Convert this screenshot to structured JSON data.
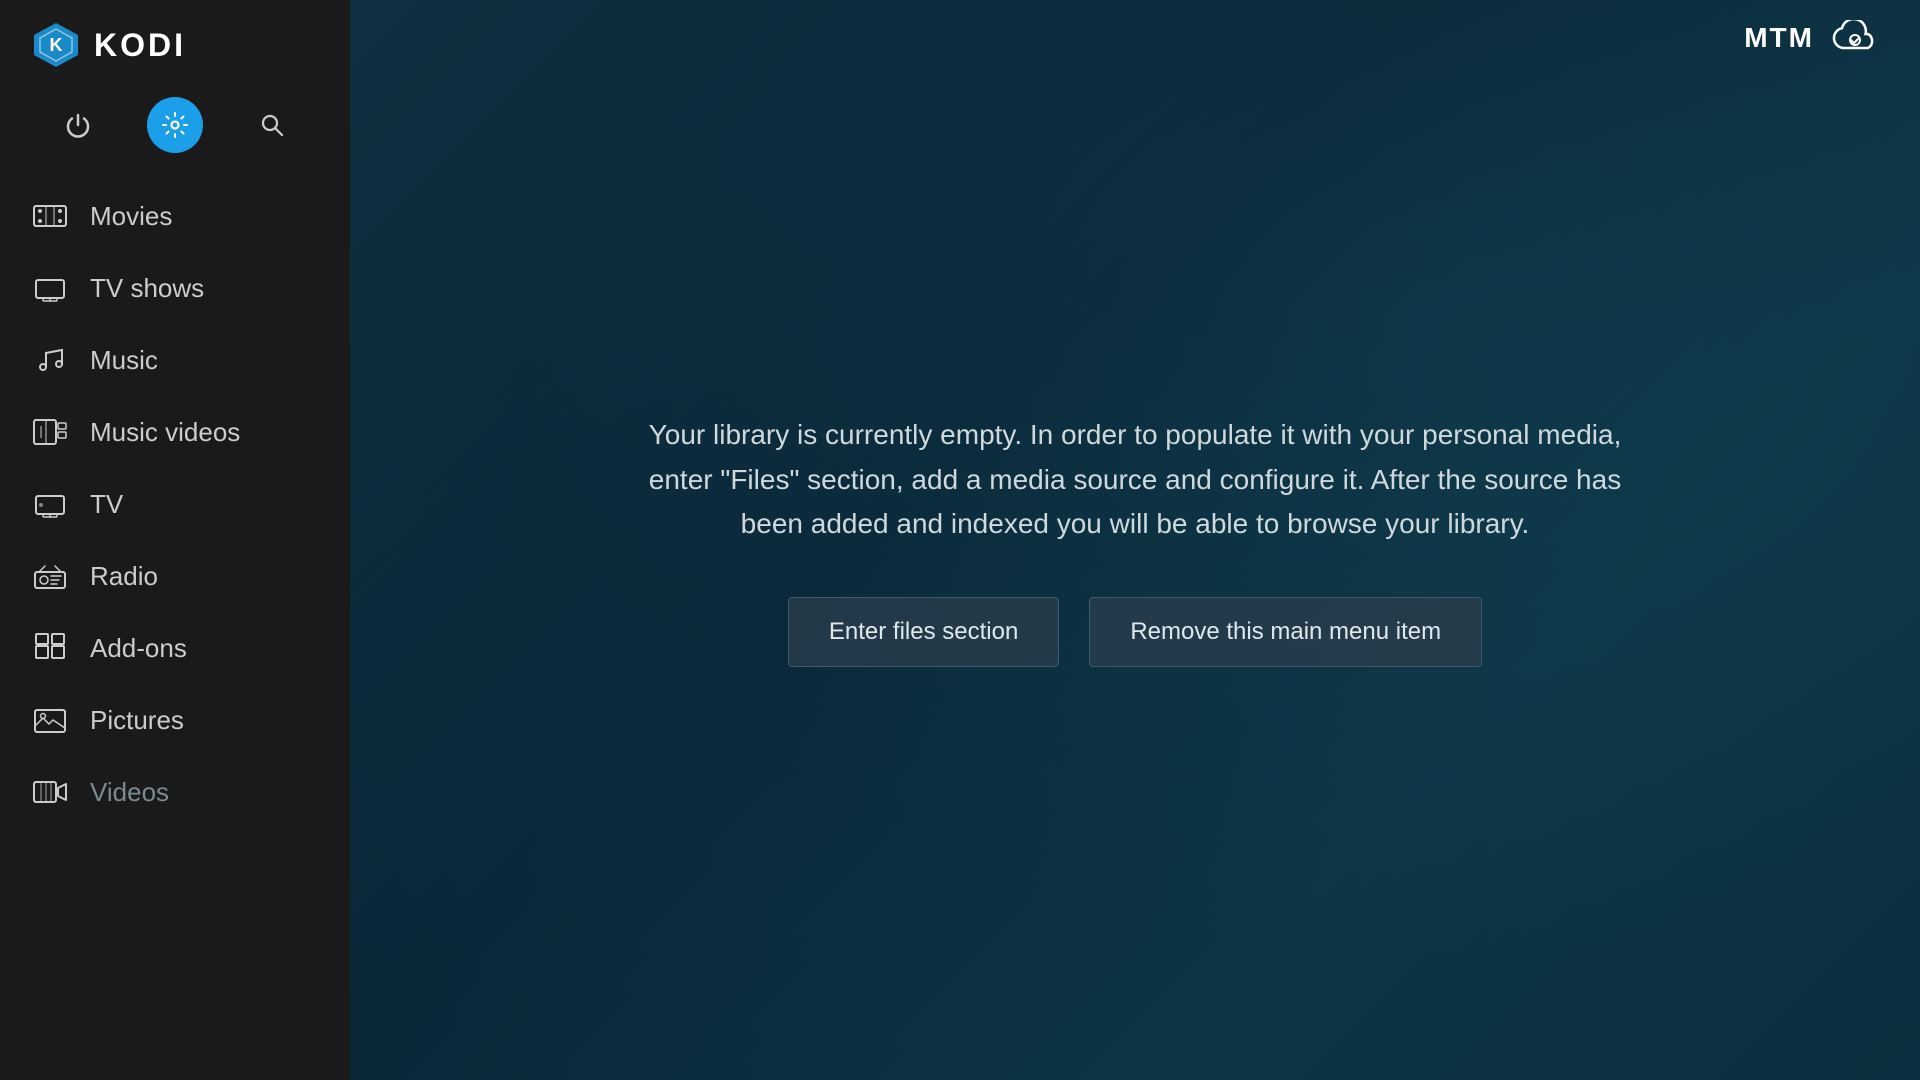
{
  "app": {
    "title": "KODI",
    "branding": "MTM"
  },
  "topbar": {
    "power_label": "⏻",
    "settings_label": "⚙",
    "search_label": "🔍"
  },
  "nav": {
    "items": [
      {
        "id": "movies",
        "label": "Movies",
        "icon": "movies-icon"
      },
      {
        "id": "tv-shows",
        "label": "TV shows",
        "icon": "tv-shows-icon"
      },
      {
        "id": "music",
        "label": "Music",
        "icon": "music-icon"
      },
      {
        "id": "music-videos",
        "label": "Music videos",
        "icon": "music-videos-icon"
      },
      {
        "id": "tv",
        "label": "TV",
        "icon": "tv-icon"
      },
      {
        "id": "radio",
        "label": "Radio",
        "icon": "radio-icon"
      },
      {
        "id": "add-ons",
        "label": "Add-ons",
        "icon": "addons-icon"
      },
      {
        "id": "pictures",
        "label": "Pictures",
        "icon": "pictures-icon"
      },
      {
        "id": "videos",
        "label": "Videos",
        "icon": "videos-icon"
      }
    ]
  },
  "main": {
    "empty_text": "Your library is currently empty. In order to populate it with your personal media, enter \"Files\" section, add a media source and configure it. After the source has been added and indexed you will be able to browse your library.",
    "btn_enter_files": "Enter files section",
    "btn_remove_menu": "Remove this main menu item"
  }
}
